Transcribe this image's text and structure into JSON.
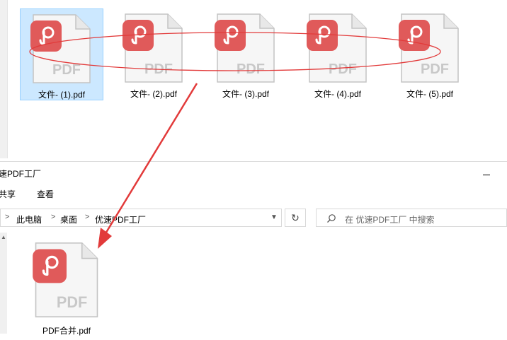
{
  "top_files": [
    {
      "name": "文件- (1).pdf",
      "selected": true
    },
    {
      "name": "文件- (2).pdf",
      "selected": false
    },
    {
      "name": "文件- (3).pdf",
      "selected": false
    },
    {
      "name": "文件- (4).pdf",
      "selected": false
    },
    {
      "name": "文件- (5).pdf",
      "selected": false
    }
  ],
  "icon": {
    "badge_text": "PDF",
    "badge_color": "#e05a5a",
    "page_color": "#f6f6f6",
    "name": "pdf-file-icon"
  },
  "window": {
    "title": "速PDF工厂",
    "ribbon_tabs": [
      "共享",
      "查看"
    ],
    "breadcrumb": [
      "此电脑",
      "桌面",
      "优速PDF工厂"
    ],
    "search_placeholder": "在 优速PDF工厂 中搜索"
  },
  "merged_file": {
    "name": "PDF合并.pdf"
  },
  "annotation": {
    "color": "#e23a3a"
  }
}
